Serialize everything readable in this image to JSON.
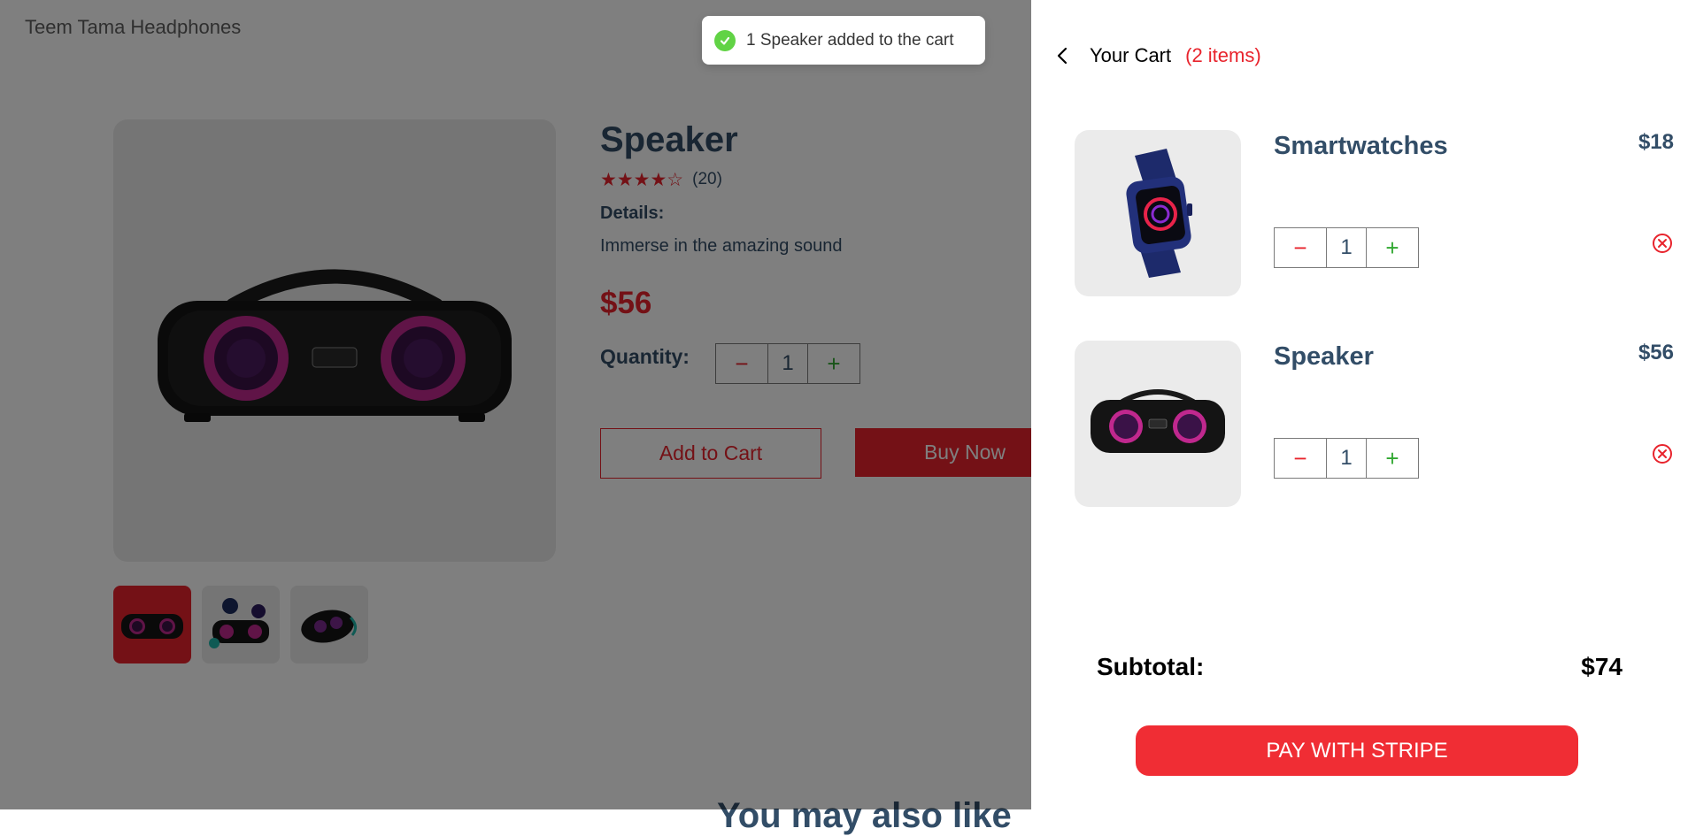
{
  "brand": "Teem Tama Headphones",
  "product": {
    "name": "Speaker",
    "stars": "★★★★☆",
    "rating_count": "(20)",
    "details_label": "Details:",
    "details": "Immerse in the amazing sound",
    "price": "$56",
    "quantity_label": "Quantity:",
    "quantity": "1",
    "add_to_cart": "Add to Cart",
    "buy_now": "Buy Now",
    "thumbnails": [
      "speaker-front",
      "speaker-party",
      "speaker-angle"
    ],
    "selected_thumbnail": 0
  },
  "section_heading": "You may also like",
  "toast": {
    "message": "1 Speaker added to the cart",
    "icon": "check-circle-icon"
  },
  "cart": {
    "title": "Your Cart",
    "count": "(2 items)",
    "items": [
      {
        "name": "Smartwatches",
        "price": "$18",
        "quantity": "1"
      },
      {
        "name": "Speaker",
        "price": "$56",
        "quantity": "1"
      }
    ],
    "subtotal_label": "Subtotal:",
    "subtotal": "$74",
    "pay_button": "PAY WITH STRIPE"
  },
  "stepper": {
    "minus": "−",
    "plus": "+"
  },
  "colors": {
    "accent": "#f02d34",
    "text": "#324d67",
    "success": "#61d345"
  }
}
